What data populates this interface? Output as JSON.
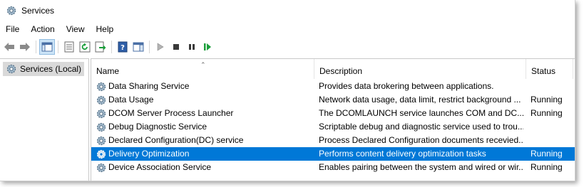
{
  "window": {
    "title": "Services"
  },
  "menu": [
    "File",
    "Action",
    "View",
    "Help"
  ],
  "tree": {
    "root_label": "Services (Local)"
  },
  "columns": {
    "name": "Name",
    "description": "Description",
    "status": "Status"
  },
  "services": [
    {
      "name": "Data Sharing Service",
      "description": "Provides data brokering between applications.",
      "status": ""
    },
    {
      "name": "Data Usage",
      "description": "Network data usage, data limit, restrict background ...",
      "status": "Running"
    },
    {
      "name": "DCOM Server Process Launcher",
      "description": "The DCOMLAUNCH service launches COM and DC...",
      "status": "Running"
    },
    {
      "name": "Debug Diagnostic Service",
      "description": "Scriptable debug and diagnostic service used to trou...",
      "status": ""
    },
    {
      "name": "Declared Configuration(DC) service",
      "description": "Process Declared Configuration documents recevied...",
      "status": ""
    },
    {
      "name": "Delivery Optimization",
      "description": "Performs content delivery optimization tasks",
      "status": "Running"
    },
    {
      "name": "Device Association Service",
      "description": "Enables pairing between the system and wired or wir...",
      "status": "Running"
    }
  ],
  "selected_service": "Delivery Optimization",
  "colors": {
    "selection": "#0078d7",
    "play_green": "#1a9e3a"
  }
}
